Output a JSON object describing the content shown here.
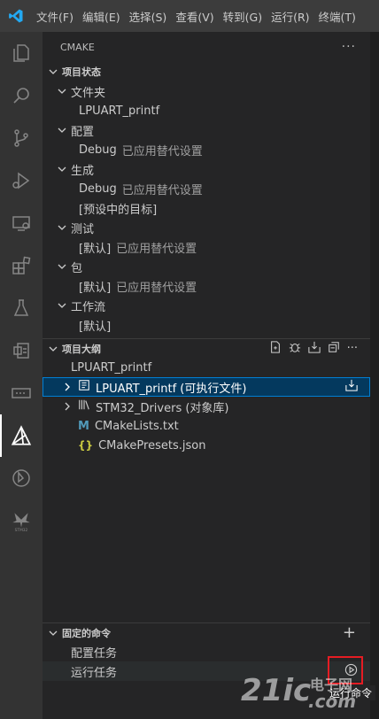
{
  "menu": [
    "文件(F)",
    "编辑(E)",
    "选择(S)",
    "查看(V)",
    "转到(G)",
    "运行(R)",
    "终端(T)"
  ],
  "sidebar": {
    "title": "CMAKE",
    "project_status": {
      "title": "项目状态",
      "groups": [
        {
          "label": "文件夹",
          "children": [
            {
              "label": "LPUART_printf",
              "extra": ""
            }
          ]
        },
        {
          "label": "配置",
          "children": [
            {
              "label": "Debug",
              "extra": "已应用替代设置"
            }
          ]
        },
        {
          "label": "生成",
          "children": [
            {
              "label": "Debug",
              "extra": "已应用替代设置"
            },
            {
              "label": "[预设中的目标]",
              "extra": ""
            }
          ]
        },
        {
          "label": "测试",
          "children": [
            {
              "label": "[默认]",
              "extra": "已应用替代设置"
            }
          ]
        },
        {
          "label": "包",
          "children": [
            {
              "label": "[默认]",
              "extra": "已应用替代设置"
            }
          ]
        },
        {
          "label": "工作流",
          "children": [
            {
              "label": "[默认]",
              "extra": ""
            }
          ]
        }
      ]
    },
    "project_outline": {
      "title": "项目大纲",
      "root": "LPUART_printf",
      "items": [
        {
          "label": "LPUART_printf (可执行文件)",
          "icon": "executable-icon",
          "expandable": true
        },
        {
          "label": "STM32_Drivers (对象库)",
          "icon": "library-icon",
          "expandable": true
        },
        {
          "label": "CMakeLists.txt",
          "icon": "cmake-file-icon",
          "expandable": false
        },
        {
          "label": "CMakePresets.json",
          "icon": "json-icon",
          "expandable": false
        }
      ]
    },
    "pinned": {
      "title": "固定的命令",
      "items": [
        "配置任务",
        "运行任务"
      ]
    }
  },
  "tooltip": "运行命令",
  "watermark": {
    "brand": "21ic",
    "sub": "电子网",
    "tld": ".com"
  },
  "colors": {
    "accent": "#007acc",
    "selected_bg": "#04395e",
    "highlight": "#e51c23"
  }
}
